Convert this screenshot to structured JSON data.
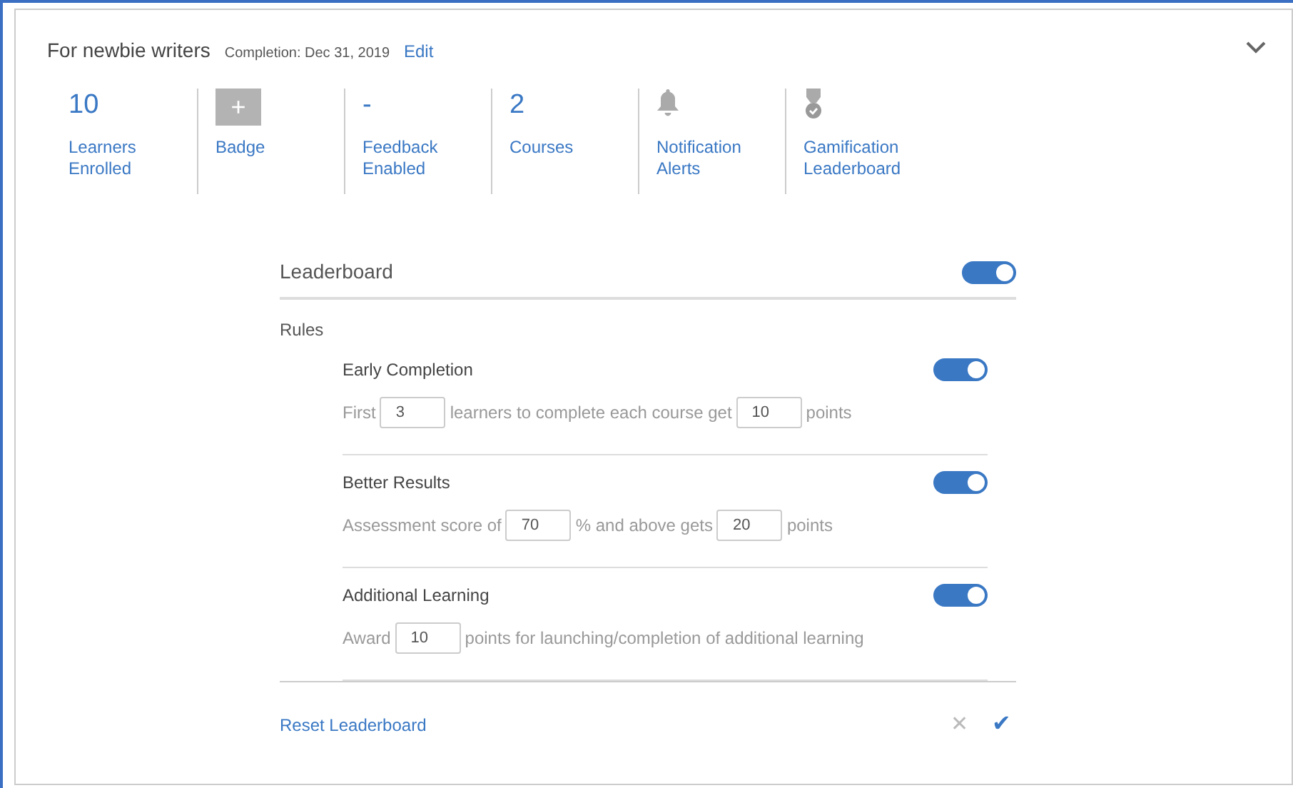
{
  "header": {
    "title": "For newbie writers",
    "completion": "Completion: Dec 31, 2019",
    "edit_link": "Edit",
    "expanded": true
  },
  "stats": [
    {
      "kind": "number",
      "value": "10",
      "label": [
        "Learners",
        "Enrolled"
      ]
    },
    {
      "kind": "badge",
      "value": "+",
      "label": [
        "Badge"
      ]
    },
    {
      "kind": "number",
      "value": "-",
      "label": [
        "Feedback",
        "Enabled"
      ]
    },
    {
      "kind": "number",
      "value": "2",
      "label": [
        "Courses"
      ]
    },
    {
      "kind": "bell",
      "label": [
        "Notification",
        "Alerts"
      ]
    },
    {
      "kind": "medal",
      "label": [
        "Gamification",
        "Leaderboard"
      ]
    }
  ],
  "leaderboard": {
    "title": "Leaderboard",
    "on": true,
    "rules_label": "Rules",
    "rules": [
      {
        "name": "Early Completion",
        "on": true,
        "parts": [
          {
            "kind": "text",
            "text": "First"
          },
          {
            "kind": "field",
            "value": "3"
          },
          {
            "kind": "text",
            "text": "learners to complete each course get"
          },
          {
            "kind": "field",
            "value": "10"
          },
          {
            "kind": "text",
            "text": "points"
          }
        ]
      },
      {
        "name": "Better Results",
        "on": true,
        "parts": [
          {
            "kind": "text",
            "text": "Assessment score of"
          },
          {
            "kind": "field",
            "value": "70"
          },
          {
            "kind": "text",
            "text": "% and above gets"
          },
          {
            "kind": "field",
            "value": "20"
          },
          {
            "kind": "text",
            "text": "points"
          }
        ]
      },
      {
        "name": "Additional Learning",
        "on": true,
        "parts": [
          {
            "kind": "text",
            "text": "Award"
          },
          {
            "kind": "field",
            "value": "10"
          },
          {
            "kind": "text",
            "text": "points for launching/completion of additional learning"
          }
        ]
      }
    ],
    "reset_link": "Reset Leaderboard",
    "cancel": "✕",
    "confirm": "✔"
  }
}
